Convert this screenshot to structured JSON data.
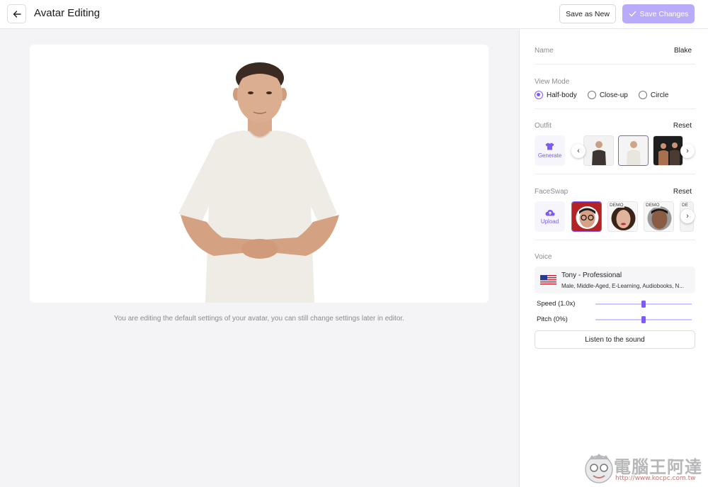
{
  "header": {
    "title": "Avatar Editing",
    "save_as_new": "Save as New",
    "save_changes": "Save Changes"
  },
  "canvas": {
    "hint": "You are editing the default settings of your avatar, you can still change settings later in editor."
  },
  "panel": {
    "name_label": "Name",
    "name_value": "Blake",
    "view_mode_label": "View Mode",
    "view_modes": [
      {
        "label": "Half-body",
        "selected": true
      },
      {
        "label": "Close-up",
        "selected": false
      },
      {
        "label": "Circle",
        "selected": false
      }
    ],
    "outfit": {
      "label": "Outfit",
      "reset": "Reset",
      "generate": "Generate",
      "selected_index": 1
    },
    "faceswap": {
      "label": "FaceSwap",
      "reset": "Reset",
      "upload": "Upload",
      "demo_tag": "DEMO",
      "partial_tag": "DE"
    },
    "voice": {
      "label": "Voice",
      "name": "Tony - Professional",
      "description": "Male, Middle-Aged, E-Learning, Audiobooks, N...",
      "speed_label": "Speed (1.0x)",
      "speed_value": 0.5,
      "pitch_label": "Pitch (0%)",
      "pitch_value": 0.5,
      "listen": "Listen to the sound"
    }
  },
  "watermark": {
    "text": "電腦王阿達",
    "url": "http://www.kocpc.com.tw"
  },
  "colors": {
    "accent": "#7d5cf5",
    "accent_light": "#b9abfa"
  }
}
